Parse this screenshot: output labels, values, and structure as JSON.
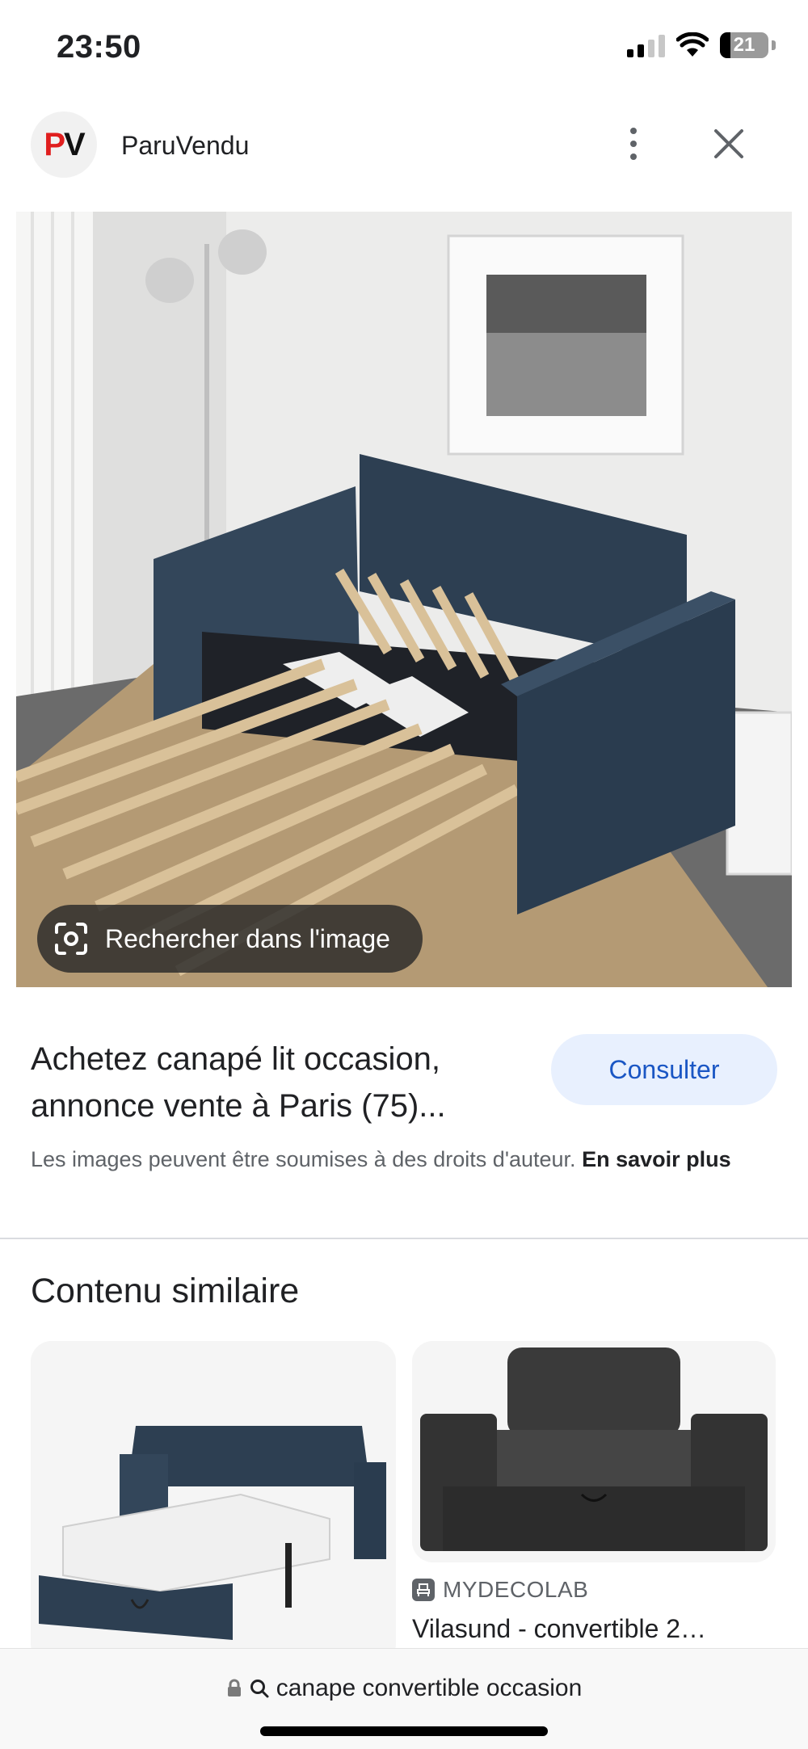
{
  "status_bar": {
    "time": "23:50",
    "battery": "21",
    "icons": [
      "signal-icon",
      "wifi-icon",
      "battery-icon"
    ]
  },
  "header": {
    "logo_text_p": "P",
    "logo_text_v": "V",
    "site_name": "ParuVendu",
    "icons": [
      "more-vert-icon",
      "close-icon"
    ]
  },
  "image": {
    "lens_label": "Rechercher dans l'image"
  },
  "result": {
    "title": "Achetez canapé lit occasion, annonce vente à Paris (75)...",
    "visit_label": "Consulter",
    "copyright_text": "Les images peuvent être soumises à des droits d'auteur.",
    "learn_more": "En savoir plus"
  },
  "similar": {
    "heading": "Contenu similaire",
    "items": [
      {
        "source": "",
        "caption": ""
      },
      {
        "source": "MYDECOLAB",
        "caption": "Vilasund - convertible 2…"
      }
    ]
  },
  "bottom_bar": {
    "url": "canape convertible occasion"
  },
  "colors": {
    "accent": "#1a56c4",
    "accent_bg": "#e8f0fe",
    "logo_red": "#e01e1e",
    "sofa_blue": "#2d3f52"
  }
}
